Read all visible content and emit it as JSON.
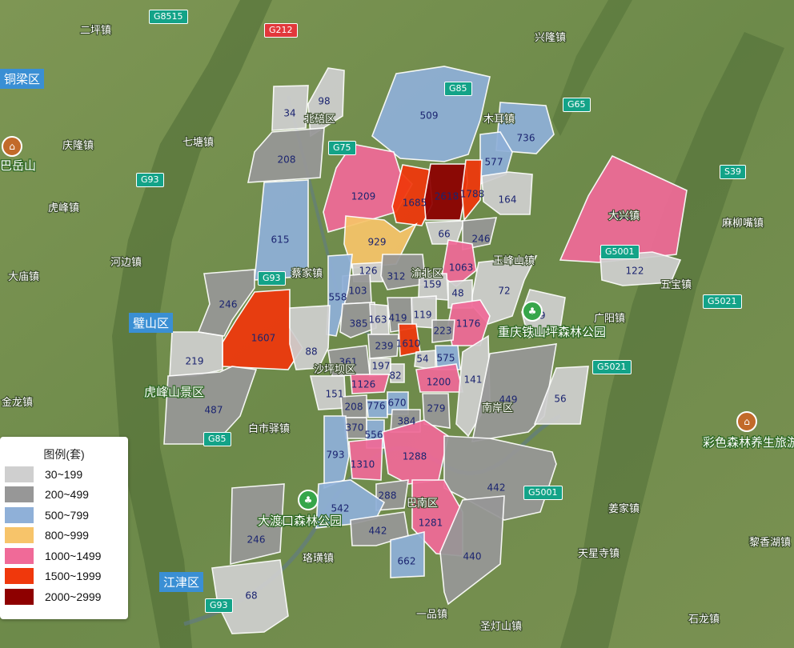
{
  "colors": {
    "c1": "#cfcfcf",
    "c2": "#979797",
    "c3": "#8fb0d8",
    "c4": "#f7c46a",
    "c5": "#f06a98",
    "c6": "#f0380c",
    "c7": "#8e0000"
  },
  "legend": {
    "title": "图例(套)",
    "items": [
      {
        "label": "30~199",
        "color": "#cfcfcf"
      },
      {
        "label": "200~499",
        "color": "#979797"
      },
      {
        "label": "500~799",
        "color": "#8fb0d8"
      },
      {
        "label": "800~999",
        "color": "#f7c46a"
      },
      {
        "label": "1000~1499",
        "color": "#f06a98"
      },
      {
        "label": "1500~1999",
        "color": "#f0380c"
      },
      {
        "label": "2000~2999",
        "color": "#8e0000"
      }
    ]
  },
  "highways": [
    "G8515",
    "G212",
    "G65",
    "G85",
    "G75",
    "G93",
    "G93",
    "S39",
    "G5001",
    "G5021",
    "G5021",
    "G85",
    "G5001",
    "G93"
  ],
  "districts": [
    "铜梁区",
    "璧山区",
    "江津区"
  ],
  "places": {
    "p1": "二坪镇",
    "p2": "庆隆镇",
    "p3": "七塘镇",
    "p4": "虎峰镇",
    "p5": "河边镇",
    "p6": "大庙镇",
    "p7": "金龙镇",
    "p8": "兴隆镇",
    "p9": "木耳镇",
    "p10": "麻柳嘴镇",
    "p11": "玉峰山镇",
    "p12": "广阳镇",
    "p13": "五宝镇",
    "p14": "姜家镇",
    "p15": "天星寺镇",
    "p16": "黎香湖镇",
    "p17": "石龙镇",
    "p18": "圣灯山镇",
    "p19": "一品镇",
    "p20": "珞璜镇",
    "p21": "白市驿镇",
    "p22": "南岸区",
    "p23": "巴南区",
    "p24": "沙坪坝区",
    "p25": "渝北区",
    "p26": "蔡家镇",
    "p27": "北碚区",
    "p28": "大兴镇"
  },
  "parks": [
    "重庆铁山坪森林公园",
    "虎峰山景区",
    "大渡口森林公园",
    "彩色森林养生旅游区",
    "巴岳山"
  ],
  "regions": [
    {
      "label": "34",
      "color": "#cfcfcf"
    },
    {
      "label": "98",
      "color": "#cfcfcf"
    },
    {
      "label": "208",
      "color": "#979797"
    },
    {
      "label": "615",
      "color": "#8fb0d8"
    },
    {
      "label": "509",
      "color": "#8fb0d8"
    },
    {
      "label": "736",
      "color": "#8fb0d8"
    },
    {
      "label": "577",
      "color": "#8fb0d8"
    },
    {
      "label": "1209",
      "color": "#f06a98"
    },
    {
      "label": "1685",
      "color": "#f0380c"
    },
    {
      "label": "2618",
      "color": "#8e0000"
    },
    {
      "label": "1788",
      "color": "#f0380c"
    },
    {
      "label": "164",
      "color": "#cfcfcf"
    },
    {
      "label": "1011",
      "color": "#f06a98"
    },
    {
      "label": "122",
      "color": "#cfcfcf"
    },
    {
      "label": "929",
      "color": "#f7c46a"
    },
    {
      "label": "66",
      "color": "#cfcfcf"
    },
    {
      "label": "246",
      "color": "#979797"
    },
    {
      "label": "1063",
      "color": "#f06a98"
    },
    {
      "label": "126",
      "color": "#cfcfcf"
    },
    {
      "label": "312",
      "color": "#979797"
    },
    {
      "label": "159",
      "color": "#cfcfcf"
    },
    {
      "label": "72",
      "color": "#cfcfcf"
    },
    {
      "label": "48",
      "color": "#cfcfcf"
    },
    {
      "label": "103",
      "color": "#979797"
    },
    {
      "label": "558",
      "color": "#8fb0d8"
    },
    {
      "label": "246",
      "color": "#979797"
    },
    {
      "label": "1607",
      "color": "#f0380c"
    },
    {
      "label": "88",
      "color": "#cfcfcf"
    },
    {
      "label": "219",
      "color": "#cfcfcf"
    },
    {
      "label": "385",
      "color": "#979797"
    },
    {
      "label": "163",
      "color": "#cfcfcf"
    },
    {
      "label": "419",
      "color": "#979797"
    },
    {
      "label": "119",
      "color": "#cfcfcf"
    },
    {
      "label": "1176",
      "color": "#f06a98"
    },
    {
      "label": "129",
      "color": "#cfcfcf"
    },
    {
      "label": "223",
      "color": "#979797"
    },
    {
      "label": "239",
      "color": "#979797"
    },
    {
      "label": "1610",
      "color": "#f0380c"
    },
    {
      "label": "54",
      "color": "#cfcfcf"
    },
    {
      "label": "575",
      "color": "#8fb0d8"
    },
    {
      "label": "361",
      "color": "#979797"
    },
    {
      "label": "197",
      "color": "#cfcfcf"
    },
    {
      "label": "82",
      "color": "#cfcfcf"
    },
    {
      "label": "1126",
      "color": "#f06a98"
    },
    {
      "label": "1200",
      "color": "#f06a98"
    },
    {
      "label": "141",
      "color": "#cfcfcf"
    },
    {
      "label": "449",
      "color": "#979797"
    },
    {
      "label": "56",
      "color": "#cfcfcf"
    },
    {
      "label": "487",
      "color": "#979797"
    },
    {
      "label": "151",
      "color": "#cfcfcf"
    },
    {
      "label": "208",
      "color": "#979797"
    },
    {
      "label": "776",
      "color": "#8fb0d8"
    },
    {
      "label": "670",
      "color": "#8fb0d8"
    },
    {
      "label": "279",
      "color": "#979797"
    },
    {
      "label": "370",
      "color": "#979797"
    },
    {
      "label": "556",
      "color": "#8fb0d8"
    },
    {
      "label": "384",
      "color": "#979797"
    },
    {
      "label": "793",
      "color": "#8fb0d8"
    },
    {
      "label": "1310",
      "color": "#f06a98"
    },
    {
      "label": "1288",
      "color": "#f06a98"
    },
    {
      "label": "442",
      "color": "#979797"
    },
    {
      "label": "288",
      "color": "#979797"
    },
    {
      "label": "542",
      "color": "#8fb0d8"
    },
    {
      "label": "442",
      "color": "#979797"
    },
    {
      "label": "1281",
      "color": "#f06a98"
    },
    {
      "label": "246",
      "color": "#979797"
    },
    {
      "label": "662",
      "color": "#8fb0d8"
    },
    {
      "label": "440",
      "color": "#979797"
    },
    {
      "label": "68",
      "color": "#cfcfcf"
    }
  ]
}
